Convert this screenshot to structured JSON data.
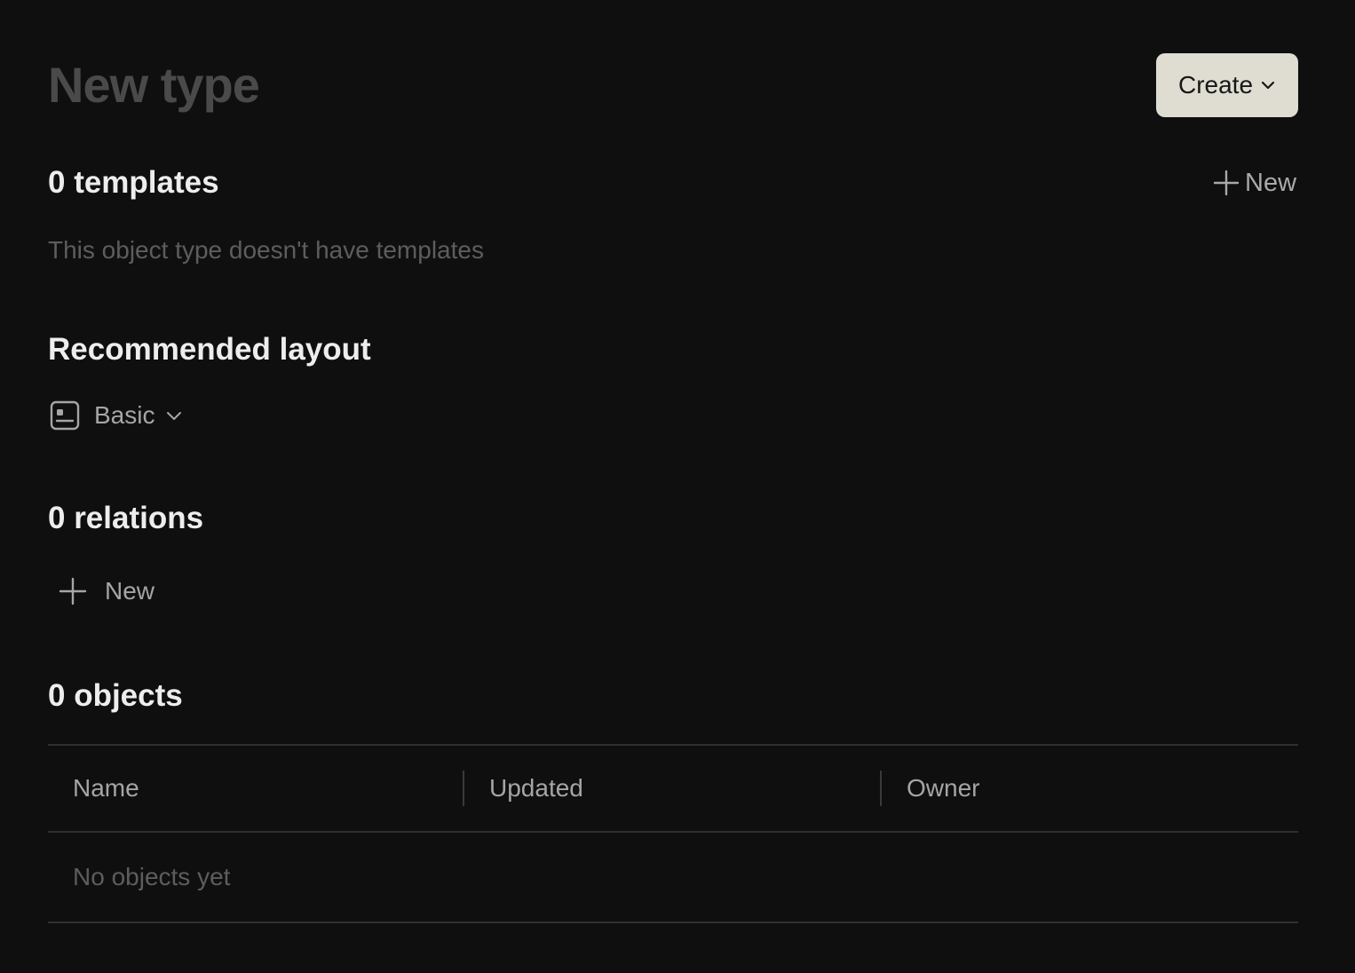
{
  "header": {
    "title": "New type",
    "create_button_label": "Create"
  },
  "templates": {
    "heading": "0 templates",
    "new_label": "New",
    "empty_text": "This object type doesn't have templates"
  },
  "layout": {
    "heading": "Recommended layout",
    "selected": "Basic",
    "icon": "basic-layout-icon"
  },
  "relations": {
    "heading": "0 relations",
    "new_label": "New"
  },
  "objects": {
    "heading": "0 objects",
    "columns": [
      "Name",
      "Updated",
      "Owner"
    ],
    "empty_text": "No objects yet"
  },
  "colors": {
    "background": "#0f0f0f",
    "create_button_bg": "#dfddd2",
    "title_placeholder": "#4a4a4a",
    "divider": "#2f2f2f"
  }
}
